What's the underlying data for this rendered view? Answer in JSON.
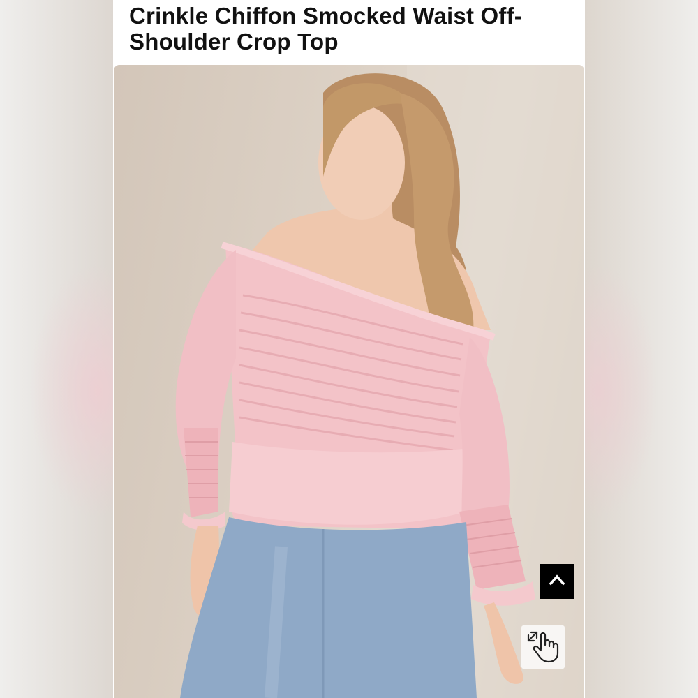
{
  "product": {
    "title": "Crinkle Chiffon Smocked Waist Off-Shoulder Crop Top",
    "image_alt": "Model wearing a pink off-shoulder smocked chiffon crop top with light blue jeans"
  },
  "controls": {
    "scroll_top_icon": "chevron-up-icon",
    "zoom_icon": "hand-pointer-expand-icon"
  },
  "colors": {
    "top_pink": "#f3c3c8",
    "jeans_blue": "#8fa9c7",
    "control_black": "#000000"
  }
}
